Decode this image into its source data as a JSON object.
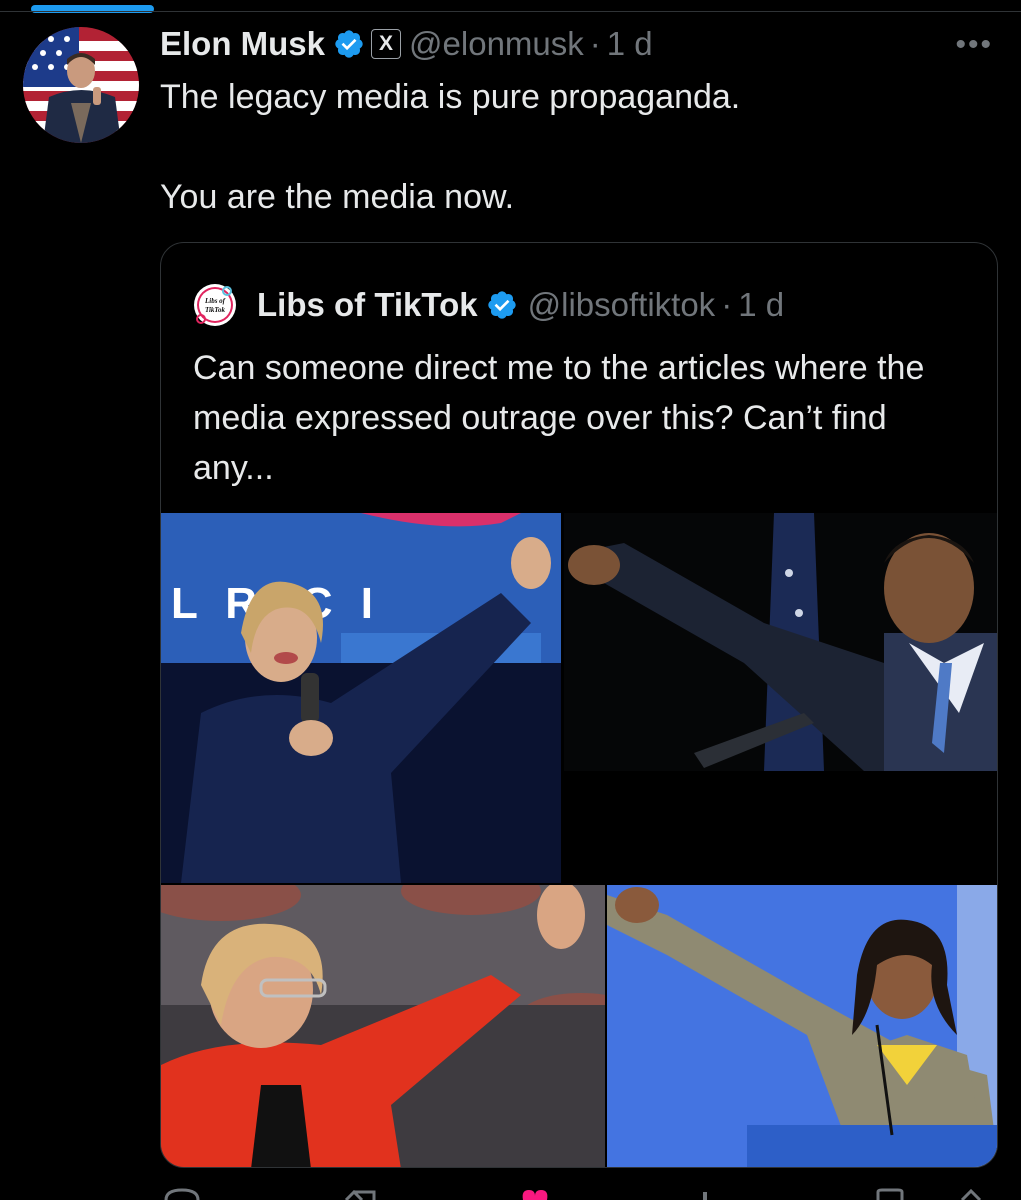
{
  "post": {
    "author_name": "Elon Musk",
    "handle": "@elonmusk",
    "separator": "·",
    "time": "1 d",
    "x_badge": "X",
    "more_label": "•••",
    "text_line1": "The legacy media is pure propaganda.",
    "text_line2": "You are the media now."
  },
  "quote": {
    "author_name": "Libs of TikTok",
    "handle": "@libsoftiktok",
    "separator": "·",
    "time": "1 d",
    "text": "Can someone direct me to the articles where the media expressed outrage over this? Can’t find any...",
    "avatar_text_1": "Libs of",
    "avatar_text_2": "TikTok"
  },
  "media": {
    "banner_text": "L   RYC  I"
  },
  "icons": {
    "verified": "verified-badge-icon",
    "more": "more-icon",
    "reply": "reply-icon",
    "repost": "repost-icon",
    "like": "heart-icon",
    "views": "views-icon",
    "bookmark": "bookmark-icon",
    "share": "share-icon"
  },
  "colors": {
    "accent": "#1d9bf0",
    "background": "#000000",
    "text": "#e7e9ea",
    "muted": "#71767b",
    "border": "#2f3336",
    "like": "#f91880"
  }
}
